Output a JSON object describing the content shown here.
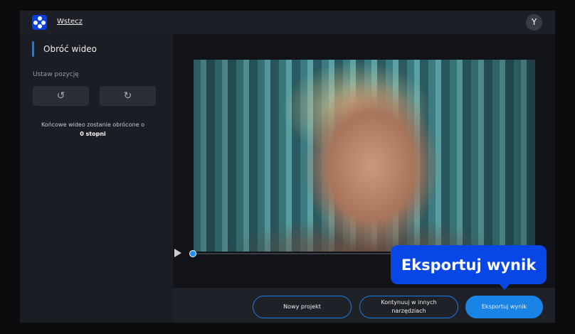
{
  "header": {
    "back_label": "Wstecz",
    "avatar_initial": "Y"
  },
  "sidebar": {
    "title": "Obróć wideo",
    "set_position_label": "Ustaw pozycję",
    "rotate_left_icon": "↺",
    "rotate_right_icon": "↻",
    "info_text": "Końcowe wideo zostanie obrócone o",
    "info_value": "0 stopni"
  },
  "player": {
    "progress": 0
  },
  "footer": {
    "new_project": "Nowy projekt",
    "continue": "Kontynuuj w innych narzędziach",
    "export": "Eksportuj wynik"
  },
  "tooltip": {
    "text": "Eksportuj wynik"
  },
  "colors": {
    "accent": "#1a84e6",
    "tooltip": "#0847e6"
  }
}
